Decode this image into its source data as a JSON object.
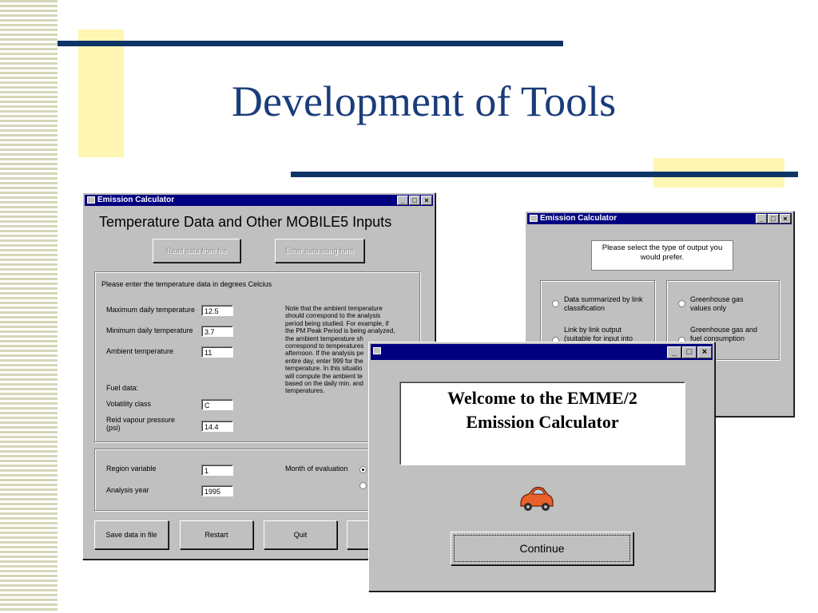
{
  "slide": {
    "title": "Development of Tools"
  },
  "inputs_window": {
    "title": "Emission Calculator",
    "heading": "Temperature Data and Other MOBILE5 Inputs",
    "read_button": "Read data from file",
    "enter_button": "Enter data using form",
    "instruction": "Please enter the temperature data in degrees Celcius",
    "max_temp_label": "Maximum daily temperature",
    "max_temp_value": "12.5",
    "min_temp_label": "Minimum daily temperature",
    "min_temp_value": "3.7",
    "ambient_label": "Ambient temperature",
    "ambient_value": "11",
    "fuel_label": "Fuel data:",
    "volatility_label": "Volatility class",
    "volatility_value": "C",
    "rvp_label": "Reid vapour pressure (psi)",
    "rvp_value": "14.4",
    "note_lines": [
      "Note that the ambient temperature",
      "should correspond to the analysis",
      "period being studied. For example, if",
      "the PM Peak Period is being analyzed,",
      "the ambient temperature sh",
      "correspond to temperatures",
      "afternoon. If the analysis pe",
      "entire day, enter 999 for the",
      "temperature. In this situatio",
      "will compute the ambient te",
      "based on the daily min. and",
      "temperatures."
    ],
    "region_label": "Region variable",
    "region_value": "1",
    "year_label": "Analysis year",
    "year_value": "1995",
    "month_label": "Month of evaluation",
    "save_button": "Save data in file",
    "restart_button": "Restart",
    "quit_button": "Quit"
  },
  "output_window": {
    "title": "Emission Calculator",
    "prompt": "Please select the type of output you would prefer.",
    "opt_summarized": "Data summarized by link classification",
    "opt_link_line1": "Link by link output",
    "opt_link_line2": "(suitable for input into",
    "opt_ghg_only": "Greenhouse gas values only",
    "opt_ghg_fuel_line1": "Greenhouse gas and",
    "opt_ghg_fuel_line2": "fuel consumption"
  },
  "welcome_window": {
    "welcome_text": "Welcome to the EMME/2 Emission Calculator",
    "continue_button": "Continue",
    "car_icon": "car-icon"
  },
  "colors": {
    "title_blue": "#1a3c7a",
    "rule_navy": "#0f3466",
    "accent_yellow": "#fff6b3",
    "titlebar": "#000080",
    "window_gray": "#c0c0c0"
  }
}
